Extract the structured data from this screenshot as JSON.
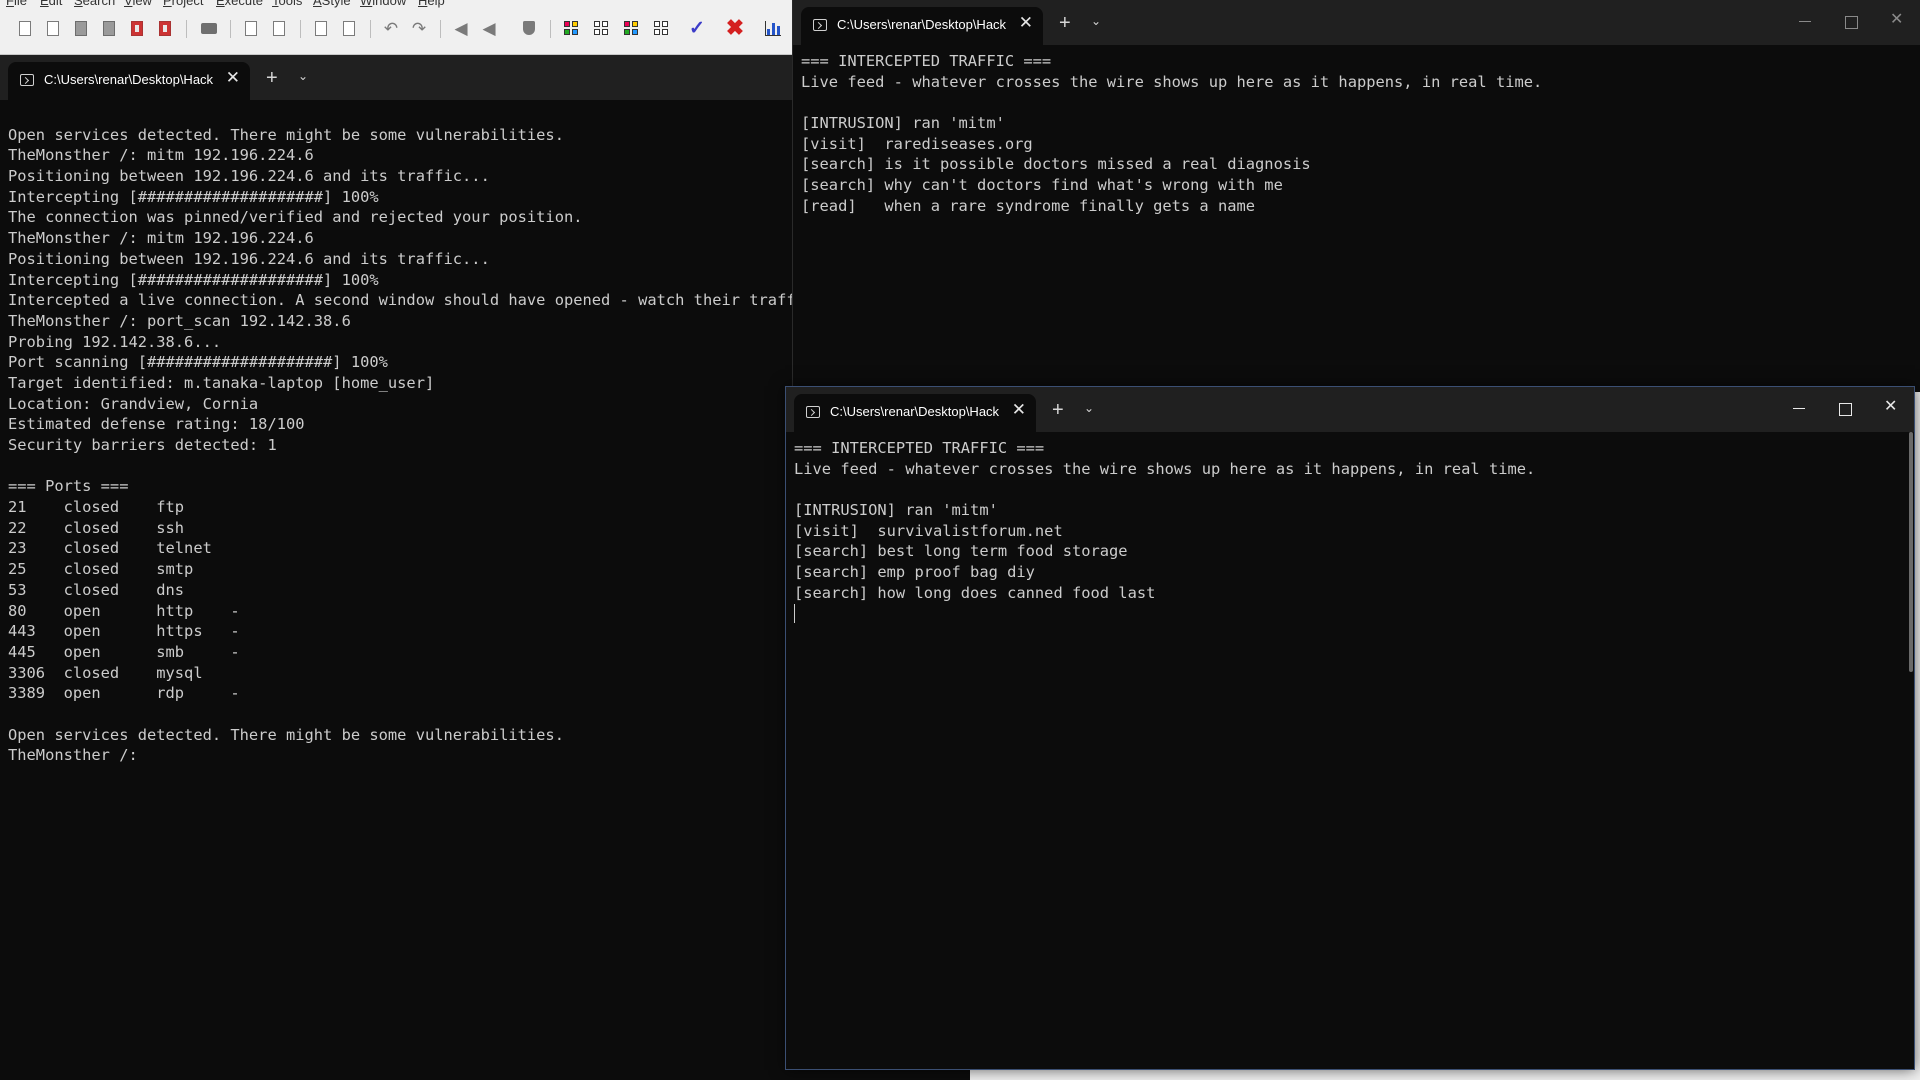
{
  "ide": {
    "menu": [
      "File",
      "Edit",
      "Search",
      "View",
      "Project",
      "Execute",
      "Tools",
      "AStyle",
      "Window",
      "Help"
    ]
  },
  "main_terminal": {
    "tab_title": "C:\\Users\\renar\\Desktop\\Hack",
    "lines": [
      "",
      "Open services detected. There might be some vulnerabilities.",
      "TheMonsther /: mitm 192.196.224.6",
      "Positioning between 192.196.224.6 and its traffic...",
      "Intercepting [####################] 100%",
      "The connection was pinned/verified and rejected your position.",
      "TheMonsther /: mitm 192.196.224.6",
      "Positioning between 192.196.224.6 and its traffic...",
      "Intercepting [####################] 100%",
      "Intercepted a live connection. A second window should have opened - watch their traffi",
      "TheMonsther /: port_scan 192.142.38.6",
      "Probing 192.142.38.6...",
      "Port scanning [####################] 100%",
      "Target identified: m.tanaka-laptop [home_user]",
      "Location: Grandview, Cornia",
      "Estimated defense rating: 18/100",
      "Security barriers detected: 1",
      "",
      "=== Ports ===",
      "21    closed    ftp",
      "22    closed    ssh",
      "23    closed    telnet",
      "25    closed    smtp",
      "53    closed    dns",
      "80    open      http    -",
      "443   open      https   -",
      "445   open      smb     -",
      "3306  closed    mysql",
      "3389  open      rdp     -",
      "",
      "Open services detected. There might be some vulnerabilities.",
      "TheMonsther /:"
    ]
  },
  "traffic_window_1": {
    "tab_title": "C:\\Users\\renar\\Desktop\\Hack",
    "lines": [
      "=== INTERCEPTED TRAFFIC ===",
      "Live feed - whatever crosses the wire shows up here as it happens, in real time.",
      "",
      "[INTRUSION] ran 'mitm'",
      "[visit]  rarediseases.org",
      "[search] is it possible doctors missed a real diagnosis",
      "[search] why can't doctors find what's wrong with me",
      "[read]   when a rare syndrome finally gets a name"
    ]
  },
  "traffic_window_2": {
    "tab_title": "C:\\Users\\renar\\Desktop\\Hack",
    "lines": [
      "=== INTERCEPTED TRAFFIC ===",
      "Live feed - whatever crosses the wire shows up here as it happens, in real time.",
      "",
      "[INTRUSION] ran 'mitm'",
      "[visit]  survivalistforum.net",
      "[search] best long term food storage",
      "[search] emp proof bag diy",
      "[search] how long does canned food last"
    ]
  },
  "icons": {
    "tab": "terminal-icon",
    "new_tab": "plus-icon",
    "dropdown": "chevron-down-icon",
    "close": "close-icon",
    "minimize": "minimize-icon",
    "maximize": "maximize-icon"
  },
  "colors": {
    "terminal_bg": "#0c0c0c",
    "terminal_text": "#cccccc",
    "titlebar_bg": "#202020",
    "active_border": "#3b4f73",
    "ide_bg": "#f0f0f0"
  }
}
